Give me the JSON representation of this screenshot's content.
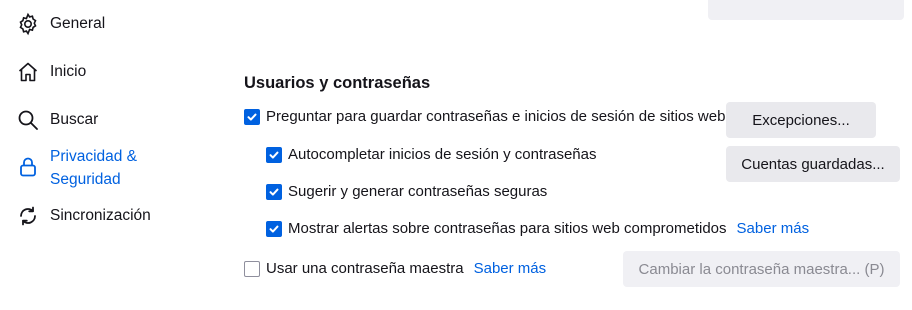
{
  "sidebar": {
    "items": [
      {
        "label": "General",
        "icon": "gear-icon"
      },
      {
        "label": "Inicio",
        "icon": "home-icon"
      },
      {
        "label": "Buscar",
        "icon": "search-icon"
      },
      {
        "label": "Privacidad & Seguridad",
        "icon": "lock-icon",
        "active": true
      },
      {
        "label": "Sincronización",
        "icon": "sync-icon"
      }
    ]
  },
  "colors": {
    "accent": "#0061e0",
    "button_bg": "#e9e9ed",
    "disabled_text": "#8a8a92"
  },
  "section": {
    "title": "Usuarios y contraseñas",
    "ask_save": {
      "label": "Preguntar para guardar contraseñas e inicios de sesión de sitios web",
      "checked": true
    },
    "autofill": {
      "label": "Autocompletar inicios de sesión y contraseñas",
      "checked": true
    },
    "suggest": {
      "label": "Sugerir y generar contraseñas seguras",
      "checked": true
    },
    "alerts": {
      "label": "Mostrar alertas sobre contraseñas para sitios web comprometidos",
      "checked": true,
      "link": "Saber más"
    },
    "master": {
      "label": "Usar una contraseña maestra",
      "checked": false,
      "link": "Saber más"
    },
    "buttons": {
      "exceptions": "Excepciones...",
      "saved_logins": "Cuentas guardadas...",
      "change_master": "Cambiar la contraseña maestra... (P)"
    }
  }
}
